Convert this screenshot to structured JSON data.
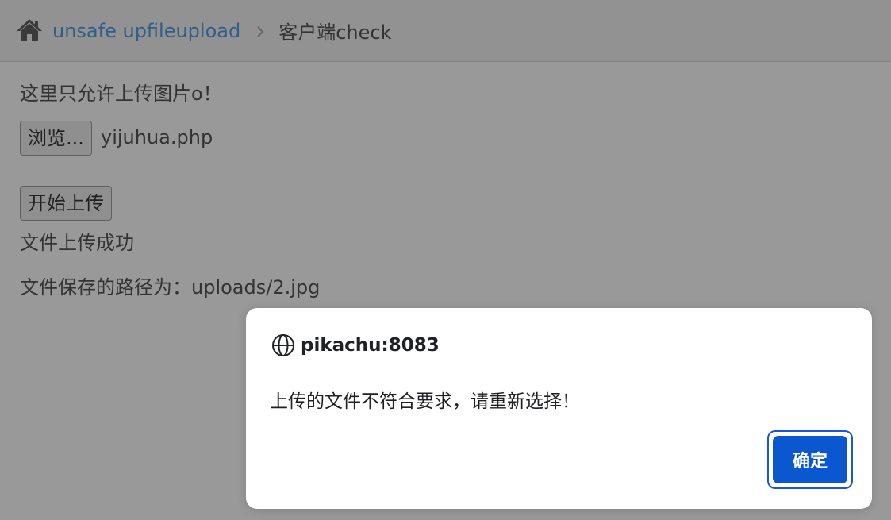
{
  "breadcrumb": {
    "home_icon": "home-icon",
    "link_label": "unsafe upfileupload",
    "separator_icon": "chevron-right-icon",
    "current_label": "客户端check"
  },
  "content": {
    "intro_text": "这里只允许上传图片o！",
    "browse_button_label": "浏览...",
    "selected_file_name": "yijuhua.php",
    "upload_button_label": "开始上传",
    "success_text": "文件上传成功",
    "saved_path_text": "文件保存的路径为：uploads/2.jpg"
  },
  "dialog": {
    "origin_icon": "globe-icon",
    "origin": "pikachu:8083",
    "message": "上传的文件不符合要求，请重新选择！",
    "ok_label": "确定"
  },
  "colors": {
    "page_background_dimmed": "#999999",
    "breadcrumb_background": "#929292",
    "link": "#2f5f8a",
    "dialog_button": "#0b57d0"
  }
}
